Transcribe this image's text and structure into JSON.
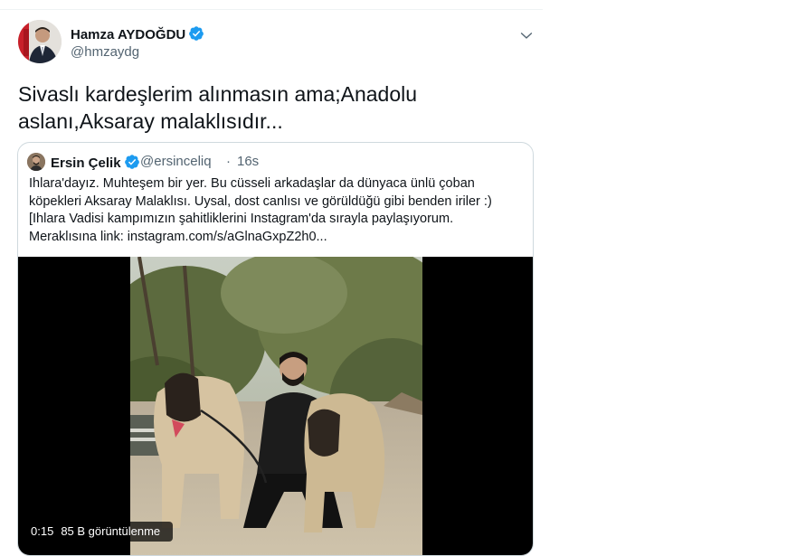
{
  "author": {
    "name": "Hamza AYDOĞDU",
    "handle": "@hmzaydg",
    "verified": true
  },
  "tweet": {
    "text_line1": "Sivaslı kardeşlerim alınmasın ama;Anadolu",
    "text_line2": "aslanı,Aksaray malaklısıdır..."
  },
  "quoted": {
    "name": "Ersin Çelik",
    "handle": "@ersinceliq",
    "separator": "·",
    "time": "16s",
    "lines": [
      "Ihlara'dayız. Muhteşem bir yer. Bu cüsseli arkadaşlar da dünyaca ünlü çoban",
      "köpekleri Aksaray Malaklısı. Uysal, dost canlısı ve görüldüğü gibi benden iriler :)",
      "[Ihlara Vadisi kampımızın şahitliklerini Instagram'da sırayla paylaşıyorum.",
      "Meraklısına link: instagram.com/s/aGlnaGxpZ2h0..."
    ]
  },
  "video": {
    "elapsed": "0:15",
    "views": "85 B görüntülenme"
  },
  "colors": {
    "verified_blue": "#1d9bf0",
    "secondary_text": "#536471",
    "border": "#cfd9de"
  },
  "icons": {
    "verified": "verified-badge-icon",
    "caret": "chevron-down-icon"
  }
}
